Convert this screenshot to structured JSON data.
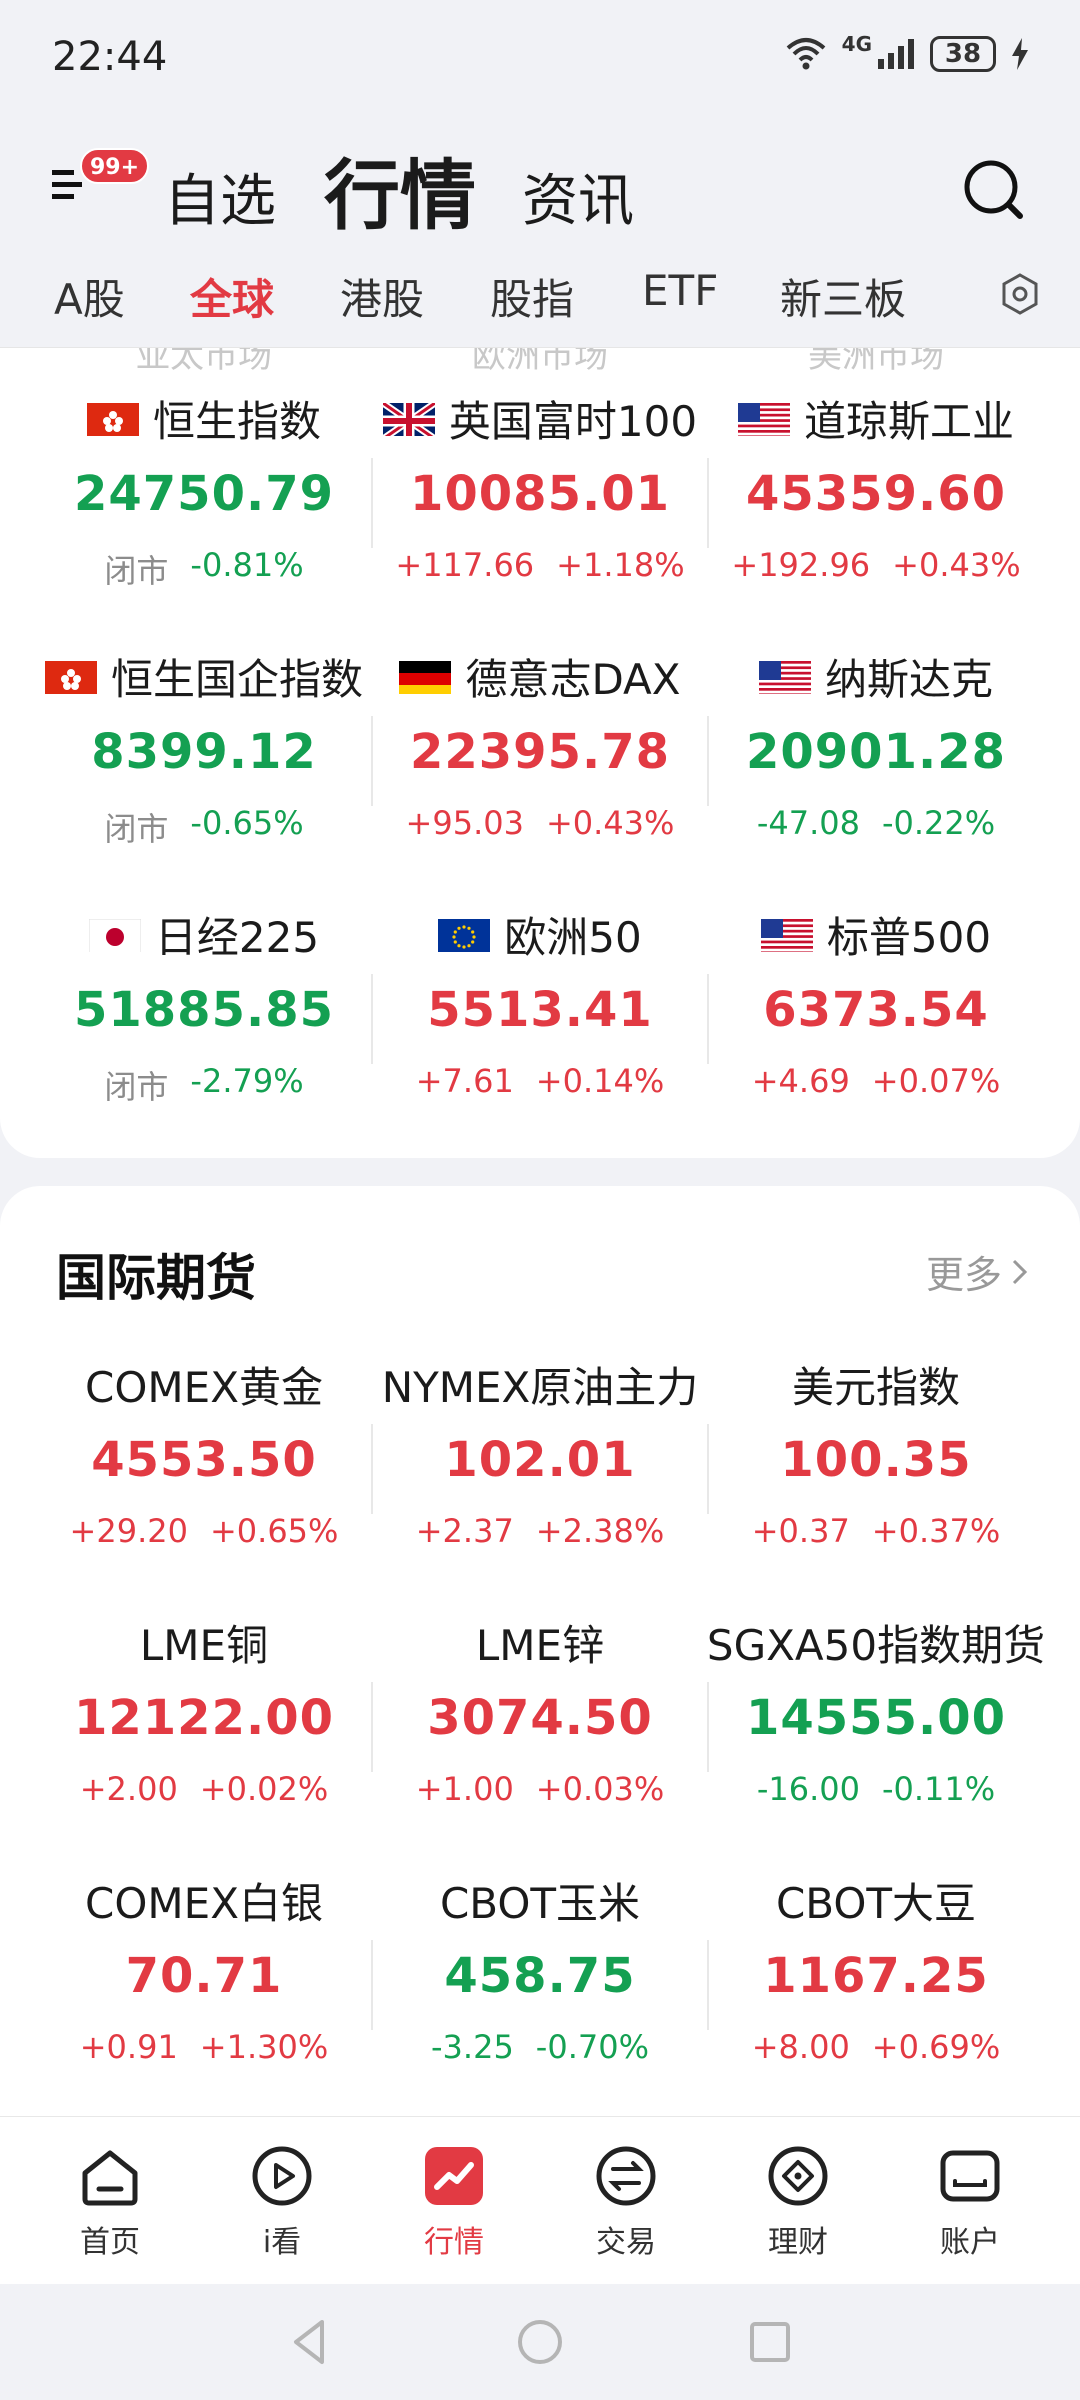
{
  "status_bar": {
    "time": "22:44",
    "network": "4G",
    "battery": "38"
  },
  "top_nav": {
    "menu_badge": "99+",
    "tabs": [
      "自选",
      "行情",
      "资讯"
    ],
    "active_tab": "行情"
  },
  "sub_tabs": {
    "items": [
      "A股",
      "全球",
      "港股",
      "股指",
      "ETF",
      "新三板"
    ],
    "active": "全球"
  },
  "indices": {
    "region_labels": [
      "亚太市场",
      "欧洲市场",
      "美洲市场"
    ],
    "items": [
      {
        "flag": "hong-kong",
        "name": "恒生指数",
        "price": "24750.79",
        "change": "闭市",
        "pct": "-0.81%",
        "trend": "down",
        "closed": true
      },
      {
        "flag": "united-kingdom",
        "name": "英国富时100",
        "price": "10085.01",
        "change": "+117.66",
        "pct": "+1.18%",
        "trend": "up",
        "closed": false
      },
      {
        "flag": "united-states",
        "name": "道琼斯工业",
        "price": "45359.60",
        "change": "+192.96",
        "pct": "+0.43%",
        "trend": "up",
        "closed": false
      },
      {
        "flag": "hong-kong",
        "name": "恒生国企指数",
        "price": "8399.12",
        "change": "闭市",
        "pct": "-0.65%",
        "trend": "down",
        "closed": true
      },
      {
        "flag": "germany",
        "name": "德意志DAX",
        "price": "22395.78",
        "change": "+95.03",
        "pct": "+0.43%",
        "trend": "up",
        "closed": false
      },
      {
        "flag": "united-states",
        "name": "纳斯达克",
        "price": "20901.28",
        "change": "-47.08",
        "pct": "-0.22%",
        "trend": "down",
        "closed": false
      },
      {
        "flag": "japan",
        "name": "日经225",
        "price": "51885.85",
        "change": "闭市",
        "pct": "-2.79%",
        "trend": "down",
        "closed": true
      },
      {
        "flag": "european-union",
        "name": "欧洲50",
        "price": "5513.41",
        "change": "+7.61",
        "pct": "+0.14%",
        "trend": "up",
        "closed": false
      },
      {
        "flag": "united-states",
        "name": "标普500",
        "price": "6373.54",
        "change": "+4.69",
        "pct": "+0.07%",
        "trend": "up",
        "closed": false
      }
    ]
  },
  "futures": {
    "title": "国际期货",
    "more": "更多",
    "items": [
      {
        "name": "COMEX黄金",
        "price": "4553.50",
        "change": "+29.20",
        "pct": "+0.65%",
        "trend": "up"
      },
      {
        "name": "NYMEX原油主力",
        "price": "102.01",
        "change": "+2.37",
        "pct": "+2.38%",
        "trend": "up"
      },
      {
        "name": "美元指数",
        "price": "100.35",
        "change": "+0.37",
        "pct": "+0.37%",
        "trend": "up"
      },
      {
        "name": "LME铜",
        "price": "12122.00",
        "change": "+2.00",
        "pct": "+0.02%",
        "trend": "up"
      },
      {
        "name": "LME锌",
        "price": "3074.50",
        "change": "+1.00",
        "pct": "+0.03%",
        "trend": "up"
      },
      {
        "name": "SGXA50指数期货",
        "price": "14555.00",
        "change": "-16.00",
        "pct": "-0.11%",
        "trend": "down"
      },
      {
        "name": "COMEX白银",
        "price": "70.71",
        "change": "+0.91",
        "pct": "+1.30%",
        "trend": "up"
      },
      {
        "name": "CBOT玉米",
        "price": "458.75",
        "change": "-3.25",
        "pct": "-0.70%",
        "trend": "down"
      },
      {
        "name": "CBOT大豆",
        "price": "1167.25",
        "change": "+8.00",
        "pct": "+0.69%",
        "trend": "up"
      }
    ]
  },
  "bottom_nav": {
    "items": [
      {
        "label": "首页",
        "icon": "home-icon"
      },
      {
        "label": "i看",
        "icon": "play-icon"
      },
      {
        "label": "行情",
        "icon": "market-icon"
      },
      {
        "label": "交易",
        "icon": "exchange-icon"
      },
      {
        "label": "理财",
        "icon": "wealth-icon"
      },
      {
        "label": "账户",
        "icon": "account-icon"
      }
    ],
    "active": "行情"
  },
  "colors": {
    "up": "#e23a43",
    "down": "#14a052",
    "accent": "#e23a43",
    "muted": "#8c8c8c"
  }
}
